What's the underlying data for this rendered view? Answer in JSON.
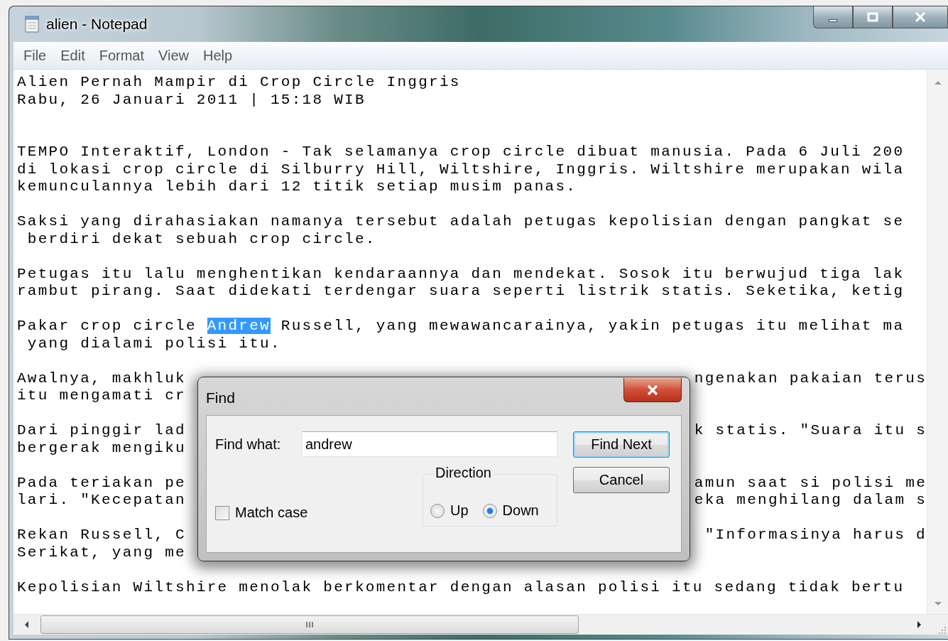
{
  "window": {
    "title": "alien - Notepad"
  },
  "menu": [
    "File",
    "Edit",
    "Format",
    "View",
    "Help"
  ],
  "document": {
    "lines": [
      {
        "kind": "plain",
        "text": "Alien Pernah Mampir di Crop Circle Inggris"
      },
      {
        "kind": "plain",
        "text": "Rabu, 26 Januari 2011 | 15:18 WIB"
      },
      {
        "kind": "blank"
      },
      {
        "kind": "blank"
      },
      {
        "kind": "plain",
        "text": "TEMPO Interaktif, London - Tak selamanya crop circle dibuat manusia. Pada 6 Juli 200"
      },
      {
        "kind": "plain",
        "text": "di lokasi crop circle di Silburry Hill, Wiltshire, Inggris. Wiltshire merupakan wila"
      },
      {
        "kind": "plain",
        "text": "kemunculannya lebih dari 12 titik setiap musim panas."
      },
      {
        "kind": "blank"
      },
      {
        "kind": "plain",
        "text": "Saksi yang dirahasiakan namanya tersebut adalah petugas kepolisian dengan pangkat se"
      },
      {
        "kind": "plain",
        "text": " berdiri dekat sebuah crop circle."
      },
      {
        "kind": "blank"
      },
      {
        "kind": "plain",
        "text": "Petugas itu lalu menghentikan kendaraannya dan mendekat. Sosok itu berwujud tiga lak"
      },
      {
        "kind": "plain",
        "text": "rambut pirang. Saat didekati terdengar suara seperti listrik statis. Seketika, ketig"
      },
      {
        "kind": "blank"
      },
      {
        "kind": "highlight",
        "segments": [
          {
            "text": "Pakar crop circle ",
            "selected": false
          },
          {
            "text": "Andrew",
            "selected": true
          },
          {
            "text": " Russell, yang mewawancarainya, yakin petugas itu melihat ma",
            "selected": false
          }
        ]
      },
      {
        "kind": "plain",
        "text": " yang dialami polisi itu."
      },
      {
        "kind": "blank"
      },
      {
        "kind": "split",
        "left": "Awalnya, makhluk",
        "right": "ngenakan pakaian terus"
      },
      {
        "kind": "split",
        "left": "itu mengamati cr"
      },
      {
        "kind": "blank"
      },
      {
        "kind": "split",
        "left": "Dari pinggir lad",
        "right": "k statis. \"Suara itu s"
      },
      {
        "kind": "split",
        "left": "bergerak mengiku"
      },
      {
        "kind": "blank"
      },
      {
        "kind": "split",
        "left": "Pada teriakan pe",
        "right": "amun saat si polisi me"
      },
      {
        "kind": "split",
        "left": "lari. \"Kecepatan",
        "right": "eka menghilang dalam s"
      },
      {
        "kind": "blank"
      },
      {
        "kind": "split",
        "left": "Rekan Russell, C",
        "right": "\"Informasinya harus d"
      },
      {
        "kind": "split",
        "left": "Serikat, yang me"
      },
      {
        "kind": "blank"
      },
      {
        "kind": "plain",
        "text": "Kepolisian Wiltshire menolak berkomentar dengan alasan polisi itu sedang tidak bertu"
      }
    ]
  },
  "find_dialog": {
    "title": "Find",
    "find_what": {
      "label": "Find what:",
      "value": "andrew"
    },
    "match_case": {
      "label": "Match case",
      "checked": false
    },
    "direction": {
      "label": "Direction",
      "options": [
        {
          "label": "Up",
          "selected": false
        },
        {
          "label": "Down",
          "selected": true
        }
      ]
    },
    "buttons": [
      {
        "label": "Find Next",
        "default": true
      },
      {
        "label": "Cancel",
        "default": false
      }
    ]
  }
}
